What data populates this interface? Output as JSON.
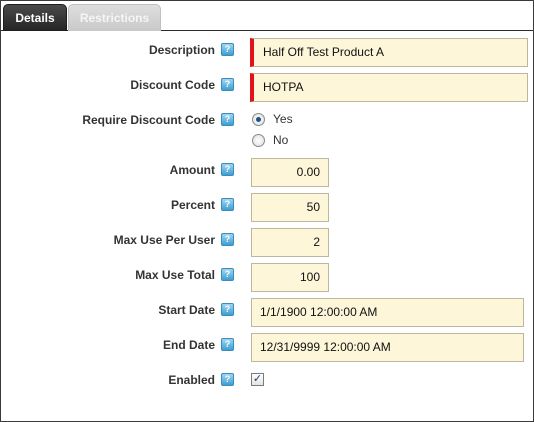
{
  "tabs": {
    "details": "Details",
    "restrictions": "Restrictions"
  },
  "help_icon_glyph": "?",
  "fields": {
    "description": {
      "label": "Description",
      "value": "Half Off Test Product A"
    },
    "discount_code": {
      "label": "Discount Code",
      "value": "HOTPA"
    },
    "require_discount_code": {
      "label": "Require Discount Code",
      "options": [
        "Yes",
        "No"
      ],
      "selected": "Yes"
    },
    "amount": {
      "label": "Amount",
      "value": "0.00"
    },
    "percent": {
      "label": "Percent",
      "value": "50"
    },
    "max_use_per_user": {
      "label": "Max Use Per User",
      "value": "2"
    },
    "max_use_total": {
      "label": "Max Use Total",
      "value": "100"
    },
    "start_date": {
      "label": "Start Date",
      "value": "1/1/1900 12:00:00 AM"
    },
    "end_date": {
      "label": "End Date",
      "value": "12/31/9999 12:00:00 AM"
    },
    "enabled": {
      "label": "Enabled",
      "checked": true,
      "check_glyph": "✓"
    }
  },
  "colors": {
    "input_background": "#fdf6d9",
    "required_marker": "#e0121a",
    "help_icon": "#3d9fd3",
    "active_tab": "#262626"
  }
}
